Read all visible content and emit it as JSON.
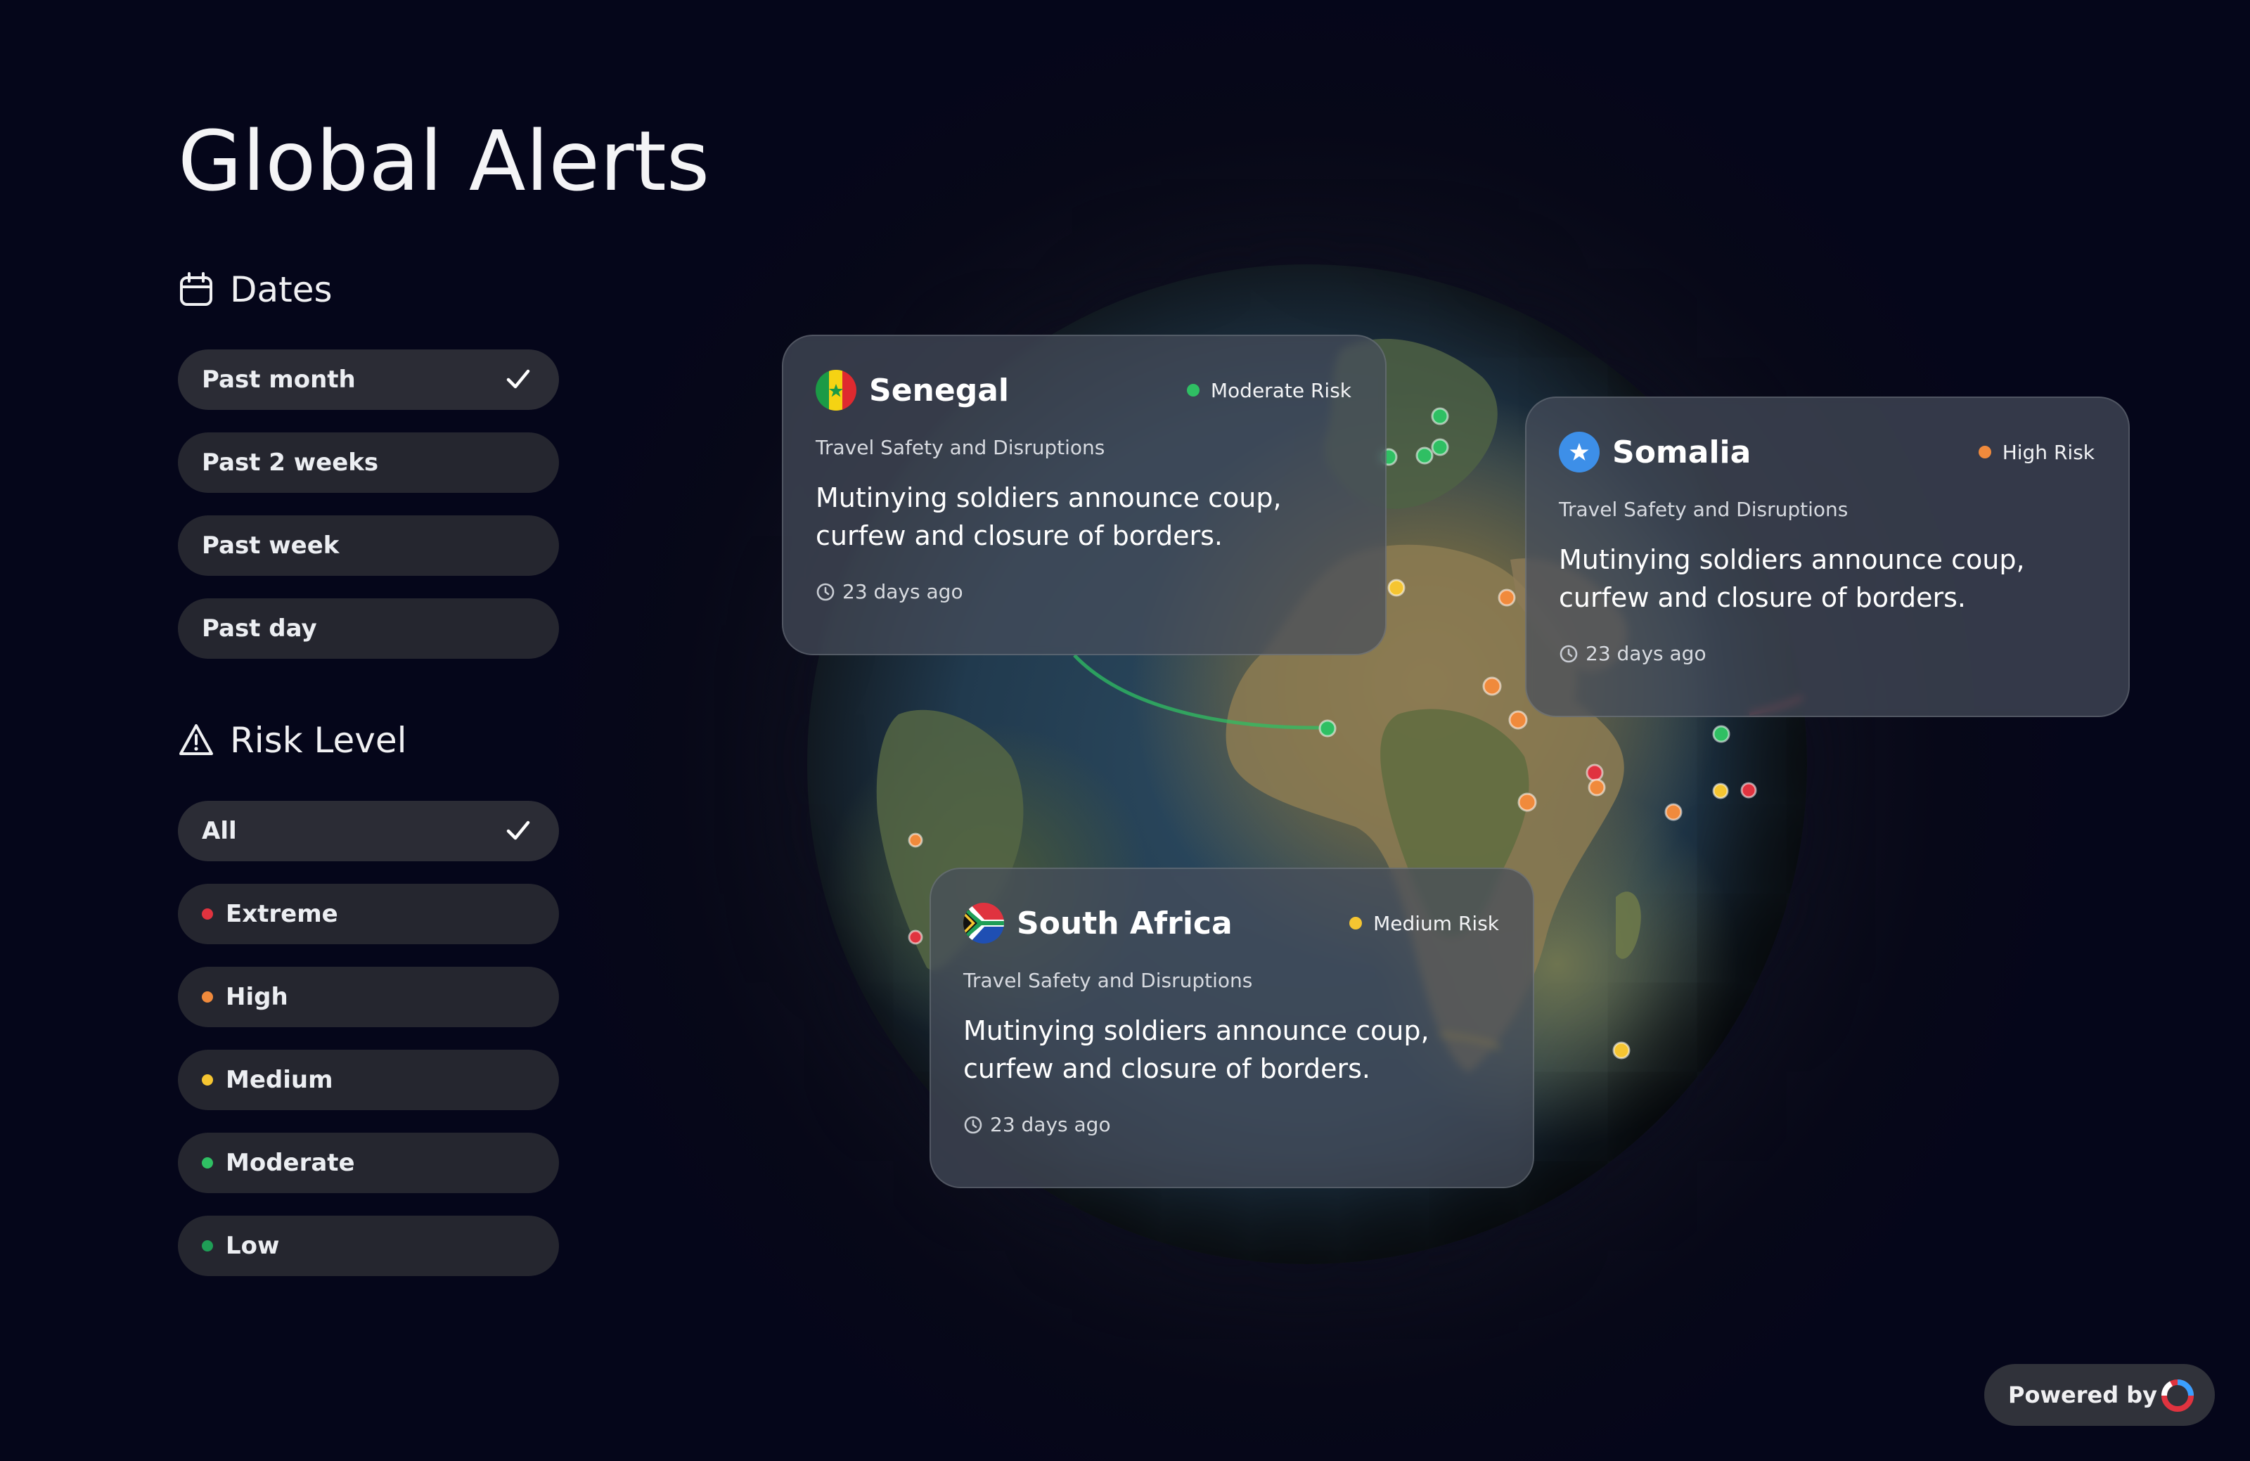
{
  "title": "Global Alerts",
  "colors": {
    "extreme": "#e0333f",
    "high": "#f08a3c",
    "medium": "#f5c531",
    "moderate": "#2fbf63",
    "low": "#1f9e56"
  },
  "dates": {
    "label": "Dates",
    "icon": "calendar-icon",
    "options": [
      {
        "label": "Past month",
        "selected": true
      },
      {
        "label": "Past 2 weeks",
        "selected": false
      },
      {
        "label": "Past week",
        "selected": false
      },
      {
        "label": "Past day",
        "selected": false
      }
    ]
  },
  "risk": {
    "label": "Risk Level",
    "icon": "warning-icon",
    "options": [
      {
        "label": "All",
        "selected": true
      },
      {
        "label": "Extreme",
        "selected": false
      },
      {
        "label": "High",
        "selected": false
      },
      {
        "label": "Medium",
        "selected": false
      },
      {
        "label": "Moderate",
        "selected": false
      },
      {
        "label": "Low",
        "selected": false
      }
    ]
  },
  "alerts": [
    {
      "country": "Senegal",
      "risk": "Moderate Risk",
      "category": "Travel Safety and Disruptions",
      "headline": "Mutinying soldiers announce coup, curfew and closure of borders.",
      "time": "23 days ago"
    },
    {
      "country": "Somalia",
      "risk": "High Risk",
      "category": "Travel Safety and Disruptions",
      "headline": "Mutinying soldiers announce coup, curfew and closure of borders.",
      "time": "23 days ago"
    },
    {
      "country": "South Africa",
      "risk": "Medium Risk",
      "category": "Travel Safety and Disruptions",
      "headline": "Mutinying soldiers announce coup, curfew and closure of borders.",
      "time": "23 days ago"
    }
  ],
  "powered_by": "Powered by"
}
